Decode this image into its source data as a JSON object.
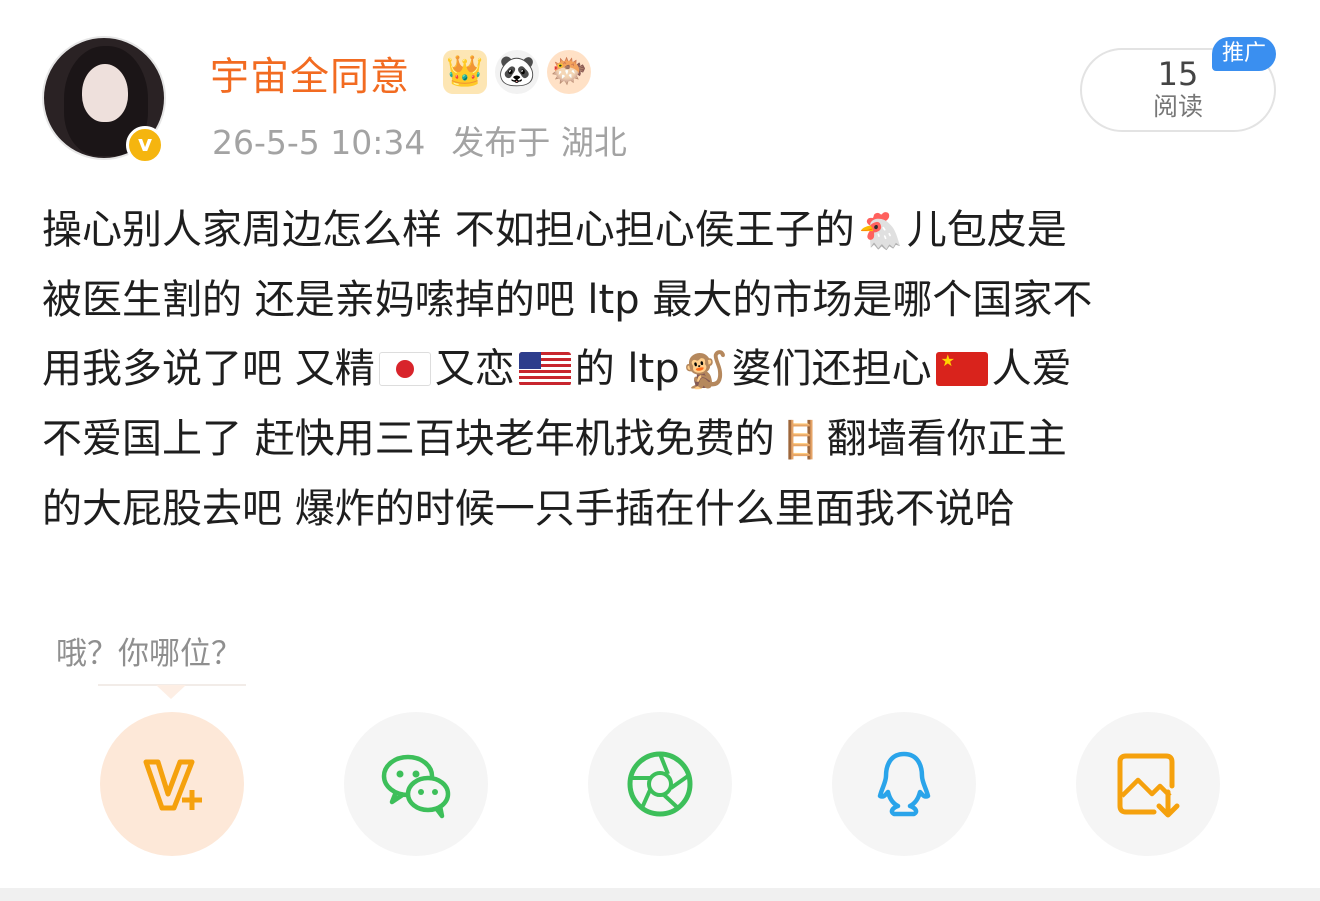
{
  "user": {
    "name": "宇宙全同意",
    "timestamp": "26-5-5 10:34",
    "location": "发布于 湖北",
    "verified_mark": "v"
  },
  "badges": [
    {
      "icon": "crown-badge-icon",
      "glyph": "👑"
    },
    {
      "icon": "panda-badge-icon",
      "glyph": "🐼"
    },
    {
      "icon": "fish-badge-icon",
      "glyph": "🐡"
    }
  ],
  "reads": {
    "count": "15",
    "label": "阅读"
  },
  "promo_tag": "推广",
  "post": {
    "l1a": "操心别人家周边怎么样 不如担心担心侯王子的",
    "l1_emoji": "🐔",
    "l1b": "儿包皮是",
    "l2": "被医生割的 还是亲妈嗦掉的吧 ltp 最大的市场是哪个国家不",
    "l3a": "用我多说了吧 又精",
    "l3b": "又恋",
    "l3c": "的 ltp",
    "l3_emoji": "🐒",
    "l3d": "婆们还担心",
    "l3e": "人爱",
    "l4a": "不爱国上了 赶快用三百块老年机找免费的",
    "l4_emoji": "🪜",
    "l4b": "翻墙看你正主",
    "l5": "的大屁股去吧 爆炸的时候一只手插在什么里面我不说哈"
  },
  "tooltip": "哦？你哪位？",
  "share_targets": [
    {
      "name": "weibo-vplus",
      "color": "#f5a10d"
    },
    {
      "name": "wechat",
      "color": "#3dbf5a"
    },
    {
      "name": "moments",
      "color": "#3dbf5a"
    },
    {
      "name": "qq",
      "color": "#2aa4ea"
    },
    {
      "name": "save-image",
      "color": "#f5a10d"
    }
  ]
}
